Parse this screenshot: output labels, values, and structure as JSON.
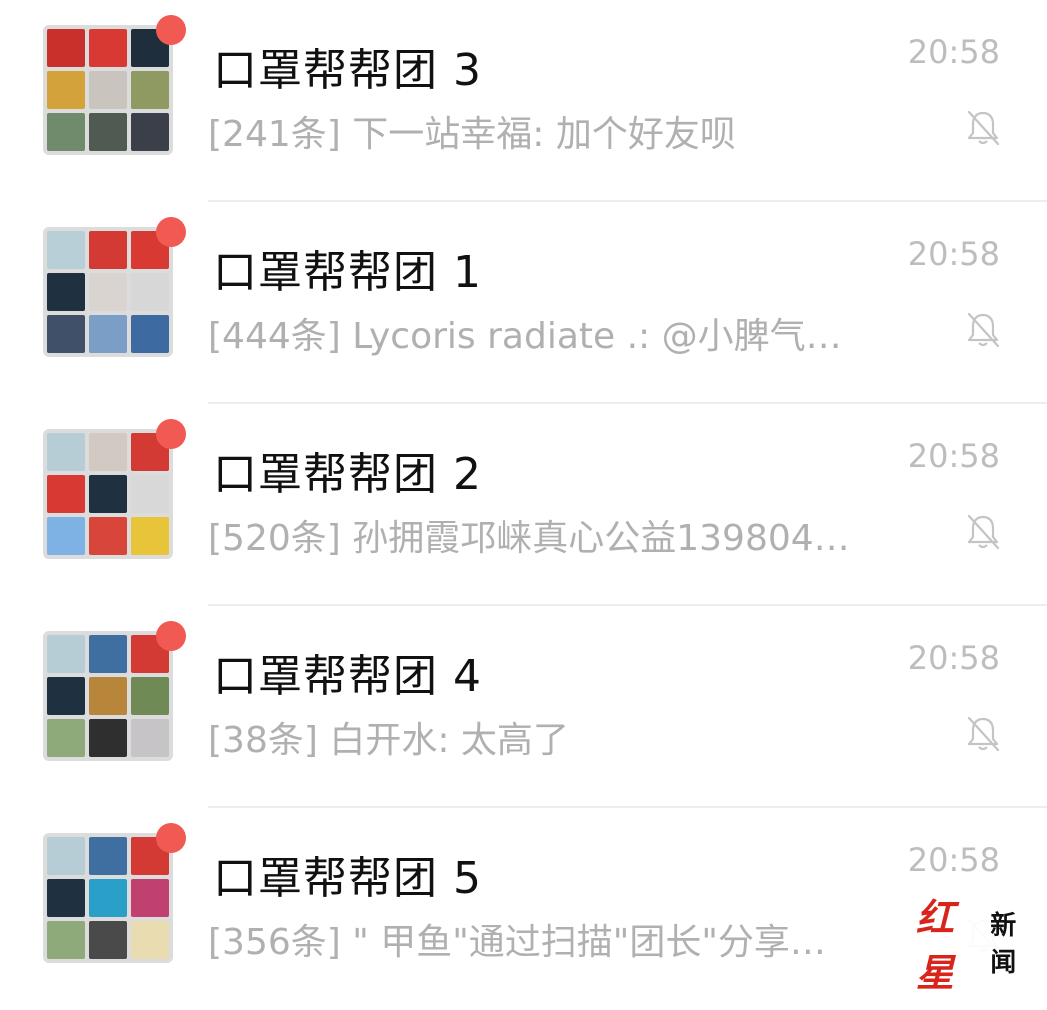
{
  "chats": [
    {
      "title": "口罩帮帮团 3",
      "time": "20:58",
      "preview": "[241条] 下一站幸福: 加个好友呗",
      "muted": true,
      "unread": true,
      "avatar_tiles": [
        "#c8302c",
        "#d83a33",
        "#1e2e3c",
        "#d4a23a",
        "#c9c4bd",
        "#8e9a62",
        "#6f8b6b",
        "#4f5a53",
        "#3a3f4a"
      ]
    },
    {
      "title": "口罩帮帮团 1",
      "time": "20:58",
      "preview": "[444条] Lycoris radiate .: @小脾气…",
      "muted": true,
      "unread": true,
      "avatar_tiles": [
        "#b9cfd8",
        "#d23a33",
        "#d83a33",
        "#1f3040",
        "#d9d4cf",
        "#d7d7d7",
        "#3f5068",
        "#7a9ec6",
        "#3d6aa0"
      ]
    },
    {
      "title": "口罩帮帮团 2",
      "time": "20:58",
      "preview": "[520条] 孙拥霞邛崃真心公益139804…",
      "muted": true,
      "unread": true,
      "avatar_tiles": [
        "#b7cdd6",
        "#d2cac2",
        "#d23a33",
        "#d83a33",
        "#1f3040",
        "#d8d8d8",
        "#7fb2e4",
        "#d8453a",
        "#e8c43a"
      ]
    },
    {
      "title": "口罩帮帮团 4",
      "time": "20:58",
      "preview": "[38条] 白开水: 太高了",
      "muted": true,
      "unread": true,
      "avatar_tiles": [
        "#b7cdd6",
        "#3f6fa0",
        "#d23a33",
        "#1f3040",
        "#b8863a",
        "#6f8a55",
        "#8faa7a",
        "#2f2f2f",
        "#c7c4c8"
      ]
    },
    {
      "title": "口罩帮帮团 5",
      "time": "20:58",
      "preview": "[356条] \" 甲鱼\"通过扫描\"团长\"分享…",
      "muted": true,
      "unread": true,
      "avatar_tiles": [
        "#b7cdd6",
        "#3f6fa0",
        "#d23a33",
        "#1f3040",
        "#2aa0c8",
        "#c04070",
        "#8faa7a",
        "#4a4a4a",
        "#e8dcb0"
      ]
    }
  ],
  "watermark": {
    "red": "红星",
    "black": "新闻"
  },
  "colors": {
    "unread_dot": "#f15a52",
    "title": "#111111",
    "preview": "#b0b0b0",
    "time": "#bdbdbd",
    "divider": "#ededed",
    "watermark_red": "#d9241c"
  },
  "icons": {
    "mute": "bell-slash-icon"
  }
}
